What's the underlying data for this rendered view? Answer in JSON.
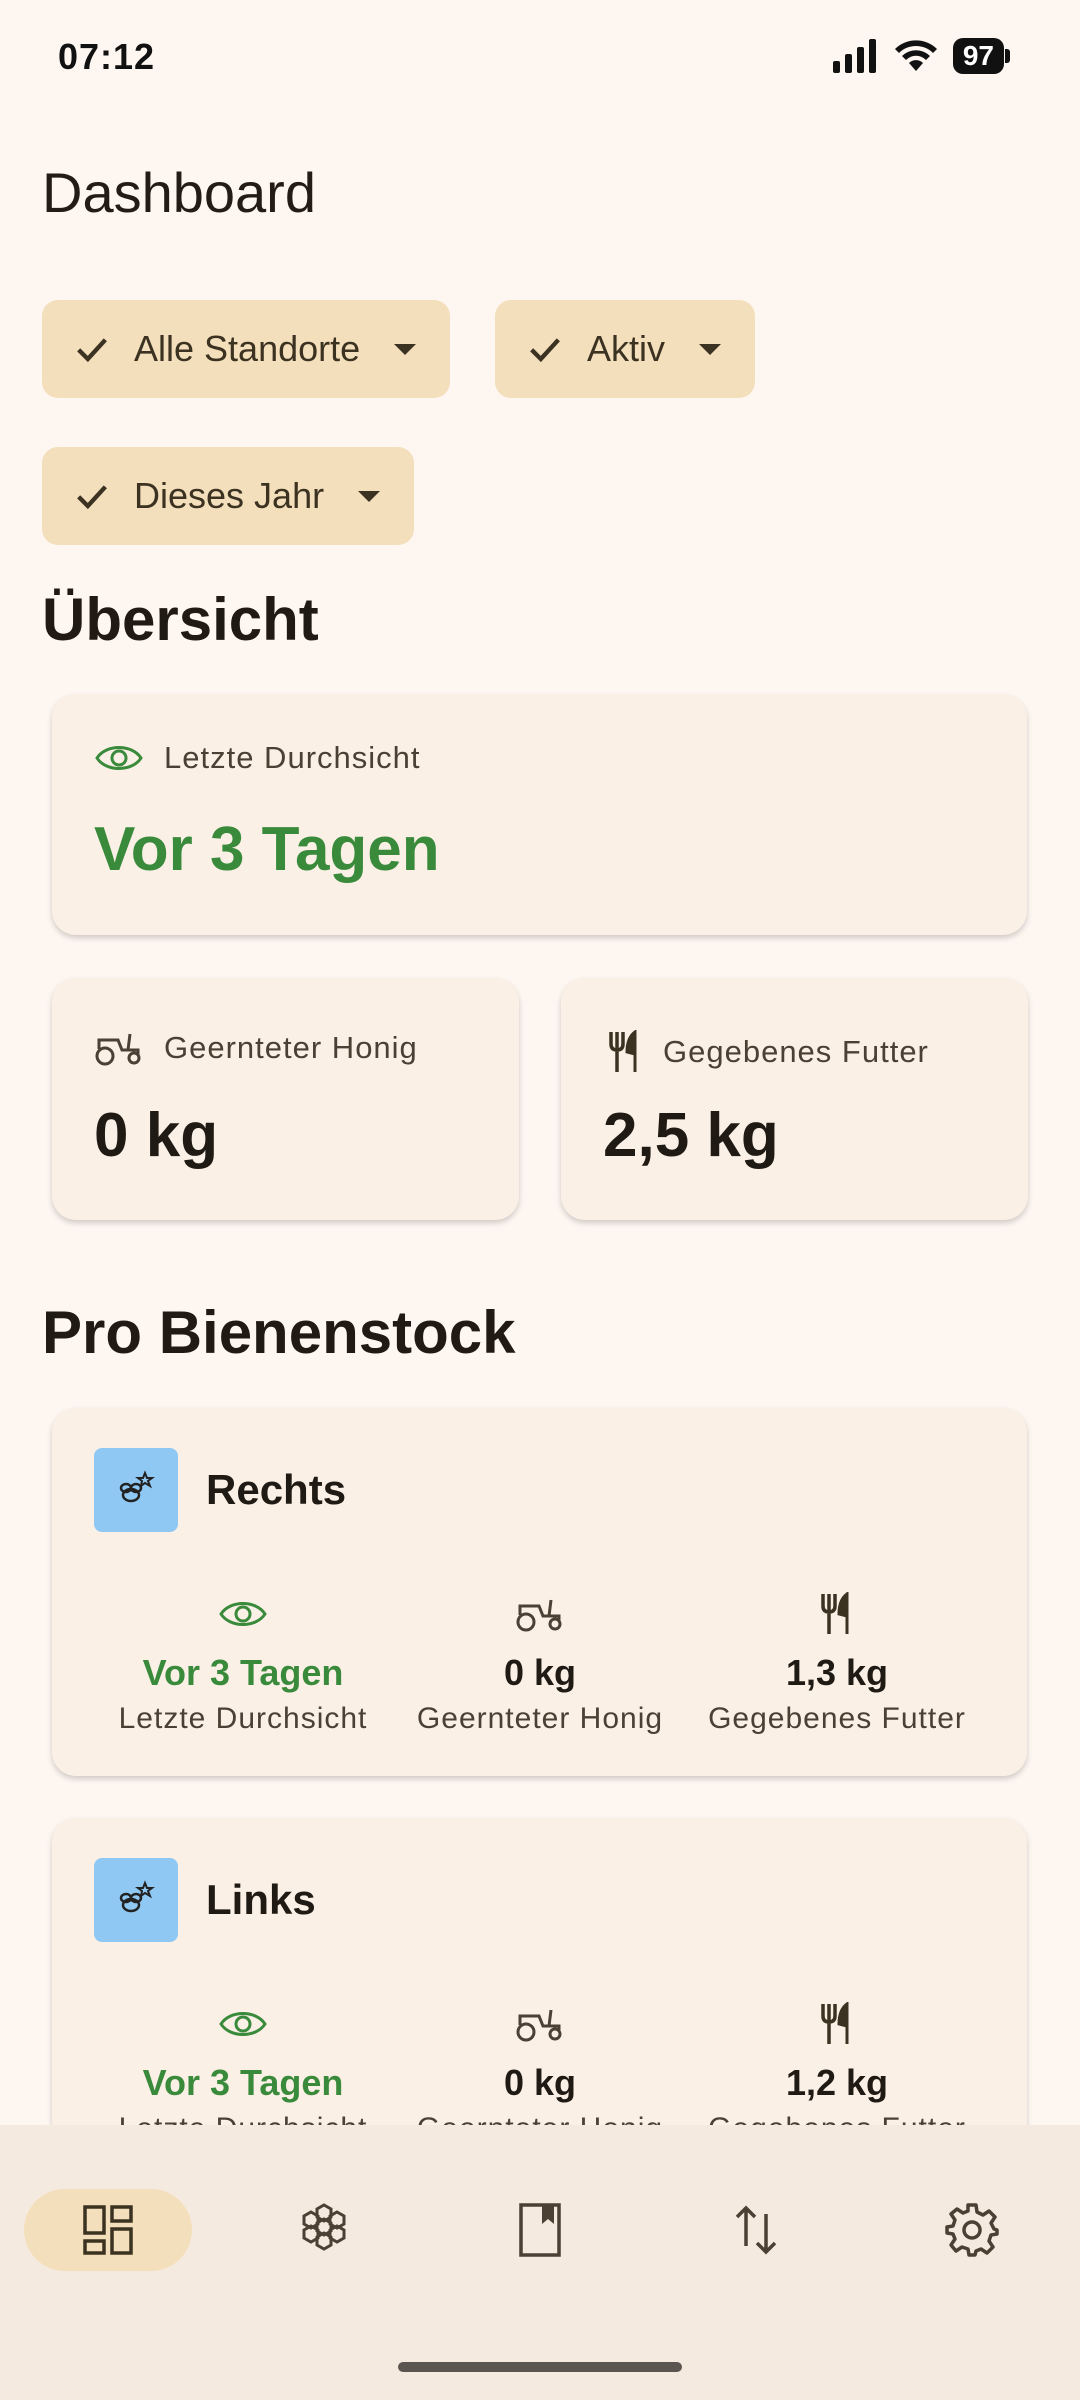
{
  "status_bar": {
    "time": "07:12",
    "battery": "97"
  },
  "page_title": "Dashboard",
  "filters": [
    {
      "label": "Alle Standorte"
    },
    {
      "label": "Aktiv"
    },
    {
      "label": "Dieses Jahr"
    }
  ],
  "overview": {
    "heading": "Übersicht",
    "last_inspection": {
      "label": "Letzte Durchsicht",
      "value": "Vor 3 Tagen"
    },
    "honey": {
      "label": "Geernteter Honig",
      "value": "0 kg"
    },
    "feed": {
      "label": "Gegebenes Futter",
      "value": "2,5 kg"
    }
  },
  "per_hive": {
    "heading": "Pro Bienenstock",
    "hives": [
      {
        "name": "Rechts",
        "inspection_value": "Vor 3 Tagen",
        "inspection_label": "Letzte Durchsicht",
        "honey_value": "0 kg",
        "honey_label": "Geernteter Honig",
        "feed_value": "1,3 kg",
        "feed_label": "Gegebenes Futter"
      },
      {
        "name": "Links",
        "inspection_value": "Vor 3 Tagen",
        "inspection_label": "Letzte Durchsicht",
        "honey_value": "0 kg",
        "honey_label": "Geernteter Honig",
        "feed_value": "1,2 kg",
        "feed_label": "Gegebenes Futter"
      }
    ]
  },
  "nav": {
    "items": [
      {
        "icon": "dashboard-icon",
        "active": true
      },
      {
        "icon": "hive-icon",
        "active": false
      },
      {
        "icon": "book-icon",
        "active": false
      },
      {
        "icon": "transfer-icon",
        "active": false
      },
      {
        "icon": "settings-icon",
        "active": false
      }
    ]
  },
  "colors": {
    "accent_green": "#3A8A3C",
    "chip_bg": "#F4DFBC",
    "card_bg": "#FAF0E6",
    "background": "#FEF6F1"
  }
}
